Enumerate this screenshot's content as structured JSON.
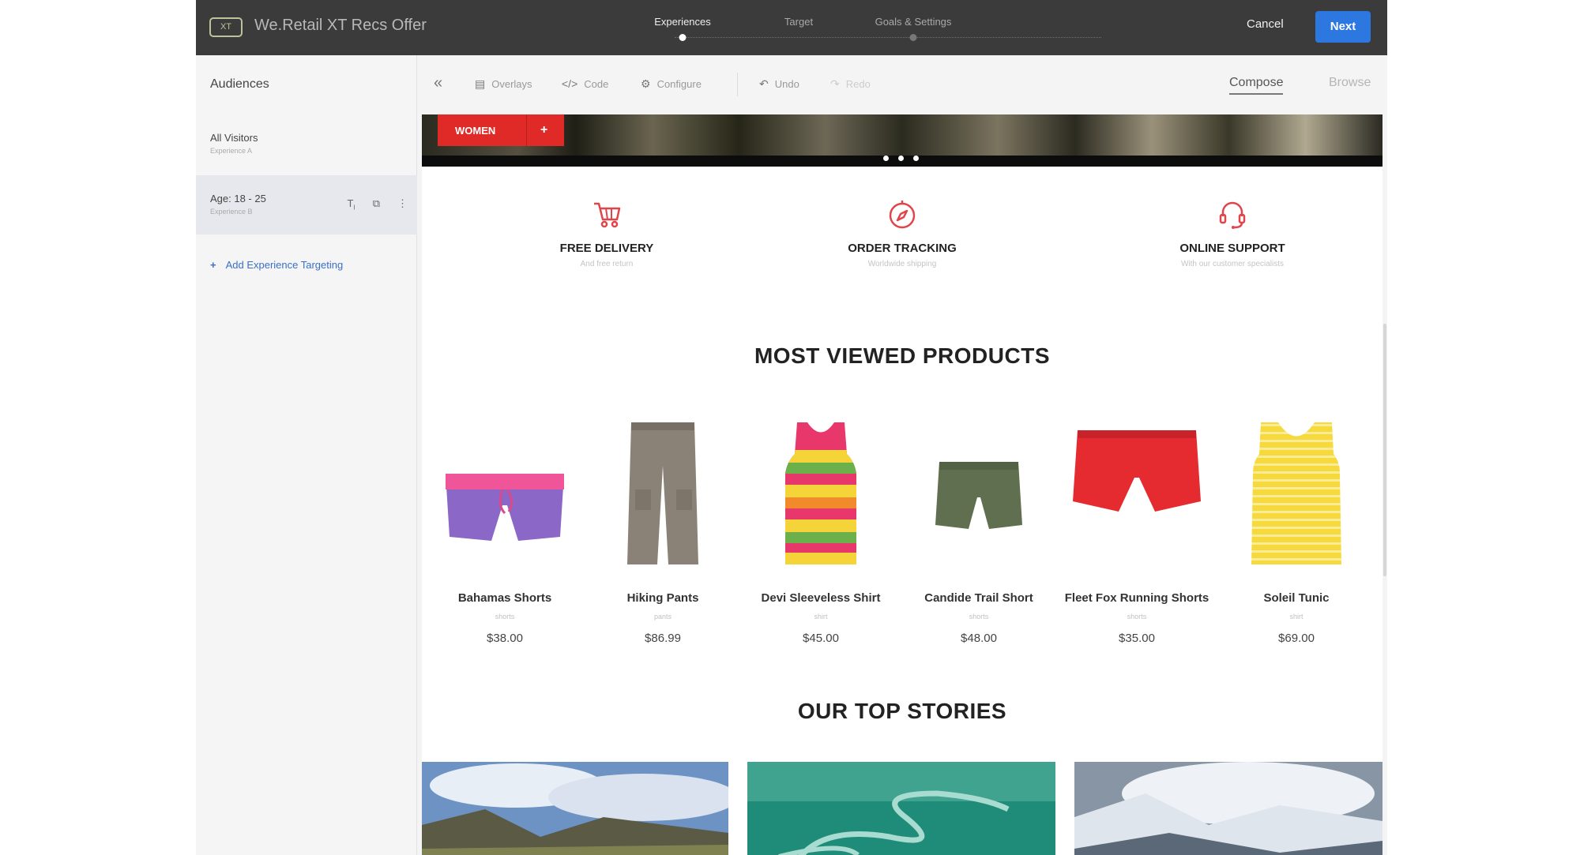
{
  "topbar": {
    "badge": "XT",
    "title": "We.Retail XT Recs Offer",
    "steps": [
      {
        "label": "Experiences",
        "active": true
      },
      {
        "label": "Target",
        "active": false
      },
      {
        "label": "Goals & Settings",
        "active": false
      }
    ],
    "cancel_label": "Cancel",
    "next_label": "Next"
  },
  "left_panel": {
    "heading": "Audiences",
    "audiences": [
      {
        "name": "All Visitors",
        "sub": "Experience A"
      },
      {
        "name": "Age: 18 - 25",
        "sub": "Experience B"
      }
    ],
    "add_label": "Add Experience Targeting"
  },
  "toolbar": {
    "collapse_icon": "double-chevron-left-icon",
    "overlays_label": "Overlays",
    "code_label": "Code",
    "configure_label": "Configure",
    "undo_label": "Undo",
    "redo_label": "Redo",
    "compose_label": "Compose",
    "browse_label": "Browse"
  },
  "hero": {
    "button_label": "WOMEN",
    "plus": "+"
  },
  "features": [
    {
      "title": "FREE DELIVERY",
      "sub": "And free return",
      "icon": "cart-icon"
    },
    {
      "title": "ORDER TRACKING",
      "sub": "Worldwide shipping",
      "icon": "compass-icon"
    },
    {
      "title": "ONLINE SUPPORT",
      "sub": "With our customer specialists",
      "icon": "headset-icon"
    }
  ],
  "most_viewed_title": "MOST VIEWED PRODUCTS",
  "products": [
    {
      "name": "Bahamas Shorts",
      "cat": "shorts",
      "price": "$38.00"
    },
    {
      "name": "Hiking Pants",
      "cat": "pants",
      "price": "$86.99"
    },
    {
      "name": "Devi Sleeveless Shirt",
      "cat": "shirt",
      "price": "$45.00"
    },
    {
      "name": "Candide Trail Short",
      "cat": "shorts",
      "price": "$48.00"
    },
    {
      "name": "Fleet Fox Running Shorts",
      "cat": "shorts",
      "price": "$35.00"
    },
    {
      "name": "Soleil Tunic",
      "cat": "shirt",
      "price": "$69.00"
    }
  ],
  "stories_title": "OUR TOP STORIES",
  "colors": {
    "topbar": "#3b3b3b",
    "primary": "#2d78e0",
    "brand_red": "#e02a28",
    "link": "#3a6fc8"
  }
}
